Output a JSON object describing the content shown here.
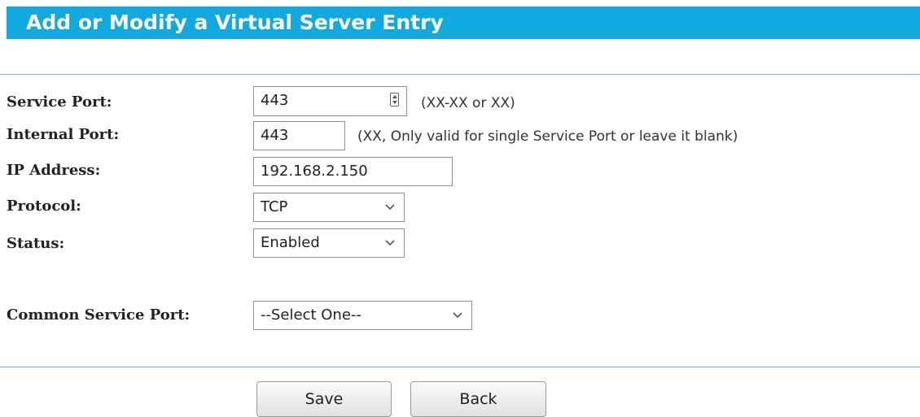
{
  "header": {
    "title": "Add or Modify a Virtual Server Entry",
    "color": "#12a9e0"
  },
  "form": {
    "service_port": {
      "label": "Service Port:",
      "value": "443",
      "hint": "(XX-XX or XX)",
      "icon": "port-spinner-icon"
    },
    "internal_port": {
      "label": "Internal Port:",
      "value": "443",
      "hint": "(XX, Only valid for single Service Port or leave it blank)"
    },
    "ip_address": {
      "label": "IP Address:",
      "value": "192.168.2.150"
    },
    "protocol": {
      "label": "Protocol:",
      "selected": "TCP",
      "icon": "chevron-down-icon"
    },
    "status": {
      "label": "Status:",
      "selected": "Enabled",
      "icon": "chevron-down-icon"
    },
    "common_service_port": {
      "label": "Common Service Port:",
      "selected": "--Select One--",
      "icon": "chevron-down-icon"
    }
  },
  "buttons": {
    "save": "Save",
    "back": "Back"
  }
}
